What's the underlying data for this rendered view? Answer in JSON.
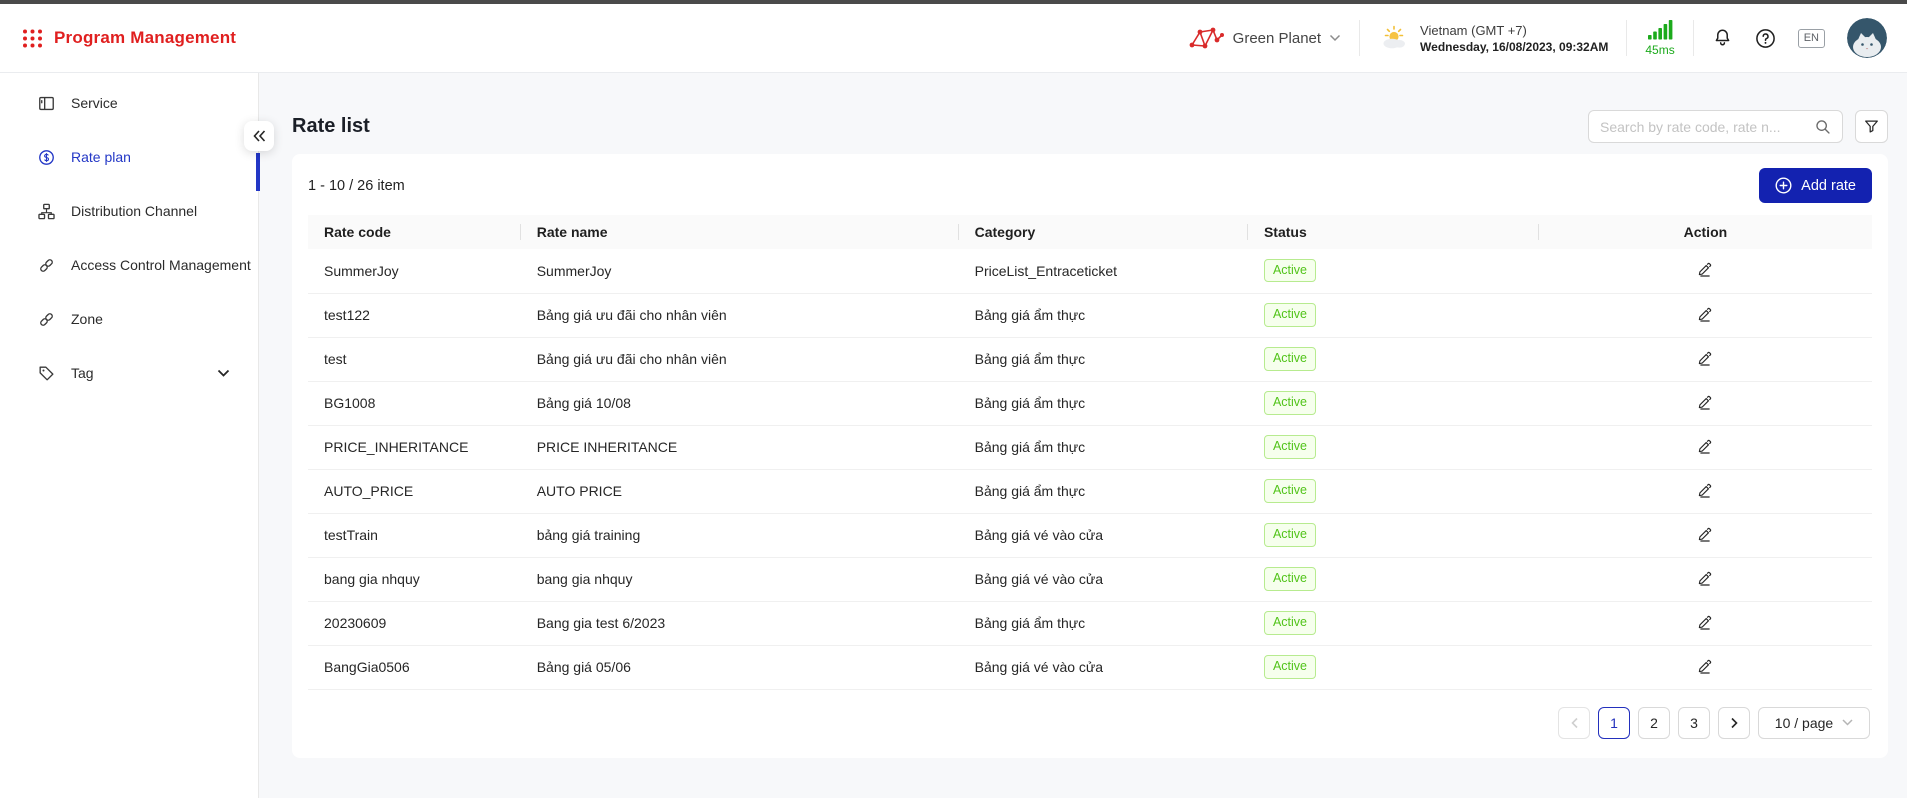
{
  "header": {
    "brand": {
      "title": "Program Management"
    },
    "org": {
      "name": "Green Planet"
    },
    "locale": {
      "region": "Vietnam (GMT +7)",
      "datetime": "Wednesday, 16/08/2023, 09:32AM"
    },
    "latency": {
      "value": "45ms"
    },
    "language": "EN"
  },
  "sidebar": {
    "items": [
      {
        "label": "Service",
        "icon": "board-icon",
        "active": false
      },
      {
        "label": "Rate plan",
        "icon": "dollar-circle-icon",
        "active": true
      },
      {
        "label": "Distribution Channel",
        "icon": "sitemap-icon",
        "active": false
      },
      {
        "label": "Access Control Management",
        "icon": "link-icon",
        "active": false
      },
      {
        "label": "Zone",
        "icon": "link-icon",
        "active": false
      },
      {
        "label": "Tag",
        "icon": "tag-icon",
        "active": false,
        "expandable": true
      }
    ]
  },
  "main": {
    "title": "Rate list",
    "search": {
      "placeholder": "Search by rate code, rate n..."
    },
    "toolbar": {
      "count": "1 - 10 / 26 item",
      "add_label": "Add rate"
    },
    "table": {
      "columns": [
        "Rate code",
        "Rate name",
        "Category",
        "Status",
        "Action"
      ],
      "rows": [
        {
          "code": "SummerJoy",
          "name": "SummerJoy",
          "category": "PriceList_Entraceticket",
          "status": "Active"
        },
        {
          "code": "test122",
          "name": "Bảng giá ưu đãi cho nhân viên",
          "category": "Bảng giá ẩm thực",
          "status": "Active"
        },
        {
          "code": "test",
          "name": "Bảng giá ưu đãi cho nhân viên",
          "category": "Bảng giá ẩm thực",
          "status": "Active"
        },
        {
          "code": "BG1008",
          "name": "Bảng giá 10/08",
          "category": "Bảng giá ẩm thực",
          "status": "Active"
        },
        {
          "code": "PRICE_INHERITANCE",
          "name": "PRICE INHERITANCE",
          "category": "Bảng giá ẩm thực",
          "status": "Active"
        },
        {
          "code": "AUTO_PRICE",
          "name": "AUTO PRICE",
          "category": "Bảng giá ẩm thực",
          "status": "Active"
        },
        {
          "code": "testTrain",
          "name": "bảng giá training",
          "category": "Bảng giá vé vào cửa",
          "status": "Active"
        },
        {
          "code": "bang gia nhquy",
          "name": "bang gia nhquy",
          "category": "Bảng giá vé vào cửa",
          "status": "Active"
        },
        {
          "code": "20230609",
          "name": "Bang gia test 6/2023",
          "category": "Bảng giá ẩm thực",
          "status": "Active"
        },
        {
          "code": "BangGia0506",
          "name": "Bảng giá 05/06",
          "category": "Bảng giá vé vào cửa",
          "status": "Active"
        }
      ]
    },
    "pagination": {
      "pages": [
        "1",
        "2",
        "3"
      ],
      "active_page": "1",
      "page_size": "10 / page"
    }
  },
  "colors": {
    "brand_red": "#e01f1f",
    "accent_blue": "#1322b0",
    "active_blue": "#2337c6",
    "status_green_text": "#52c41a",
    "status_green_border": "#b7eb8f",
    "status_green_bg": "#f6ffed",
    "latency_green": "#1caa1c"
  }
}
